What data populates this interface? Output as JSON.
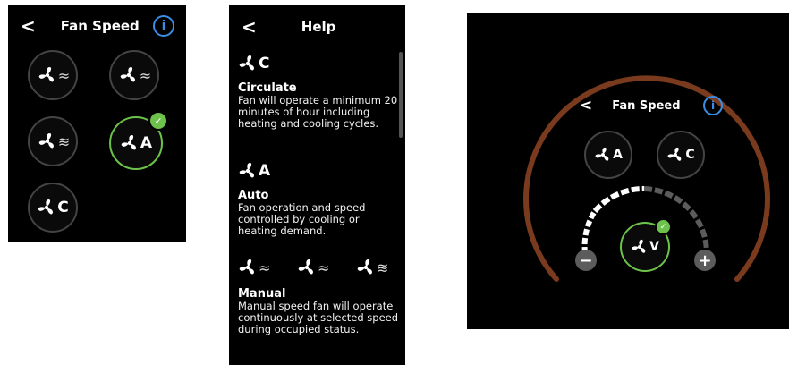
{
  "colors": {
    "accent_green": "#6cc24a",
    "info_blue": "#3a8ee6",
    "ring_brown": "#7a3a1e",
    "panel_bg": "#000000"
  },
  "panel_fan_speed": {
    "back_icon": "chevron-left-icon",
    "title": "Fan Speed",
    "info_icon": "info-icon",
    "info_glyph": "i",
    "options": [
      {
        "id": "low",
        "icon": "fan-icon",
        "suffix": "≈"
      },
      {
        "id": "medium",
        "icon": "fan-icon",
        "suffix": "≈"
      },
      {
        "id": "high",
        "icon": "fan-icon",
        "suffix": "≋"
      },
      {
        "id": "auto",
        "icon": "fan-icon",
        "suffix": "A",
        "selected": true
      },
      {
        "id": "circulate",
        "icon": "fan-icon",
        "suffix": "C"
      }
    ],
    "selected_check": "✓"
  },
  "panel_help": {
    "back_icon": "chevron-left-icon",
    "title": "Help",
    "items": [
      {
        "letter": "C",
        "title": "Circulate",
        "desc": "Fan will operate a minimum 20 minutes of hour including heating and cooling cycles."
      },
      {
        "letter": "A",
        "title": "Auto",
        "desc": "Fan operation and speed controlled by cooling or heating demand."
      },
      {
        "letter": "≈",
        "title": "Manual",
        "desc": "Manual speed fan will operate continuously at selected speed during occupied status."
      }
    ]
  },
  "panel_round": {
    "back_icon": "chevron-left-icon",
    "title": "Fan Speed",
    "info_glyph": "i",
    "auto_label": "A",
    "circulate_label": "C",
    "variable_label": "V",
    "minus_label": "−",
    "plus_label": "+",
    "speed_fraction": 0.5,
    "selected_check": "✓"
  }
}
